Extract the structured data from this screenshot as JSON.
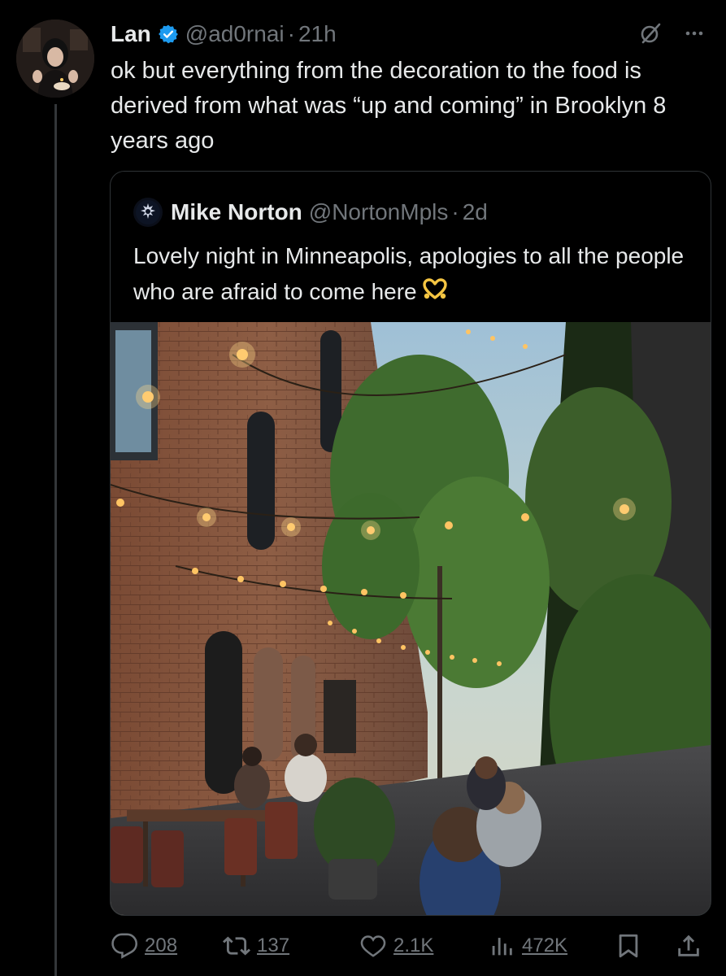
{
  "tweet": {
    "author_name": "Lan",
    "author_handle": "@ad0rnai",
    "separator": "·",
    "time": "21h",
    "text": "ok but everything from the decoration to the food is derived from what was “up and coming” in Brooklyn 8 years ago"
  },
  "quote": {
    "author_name": "Mike Norton",
    "author_handle": "@NortonMpls",
    "separator": "·",
    "time": "2d",
    "text": "Lovely night in Minneapolis, apologies to all the people who are afraid to come here",
    "emoji": "heart-hands-icon",
    "image": "photo of an evening brick courtyard patio with string lights, trees, and diners"
  },
  "actions": {
    "replies": "208",
    "reposts": "137",
    "likes": "2.1K",
    "views": "472K"
  },
  "colors": {
    "background": "#000000",
    "text": "#e7e9ea",
    "muted": "#71767b",
    "verified": "#1d9bf0",
    "border": "#2f3336"
  }
}
